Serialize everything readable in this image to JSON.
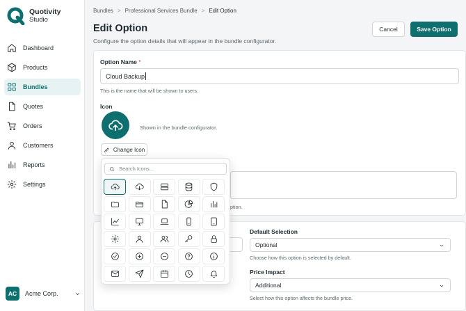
{
  "app": {
    "name": "Quotivity",
    "subtitle": "Studio"
  },
  "colors": {
    "accent": "#0f6e6e",
    "accent_light": "#e7f2f2",
    "required": "#d23b3b"
  },
  "sidebar": {
    "items": [
      {
        "label": "Dashboard",
        "icon": "home-icon"
      },
      {
        "label": "Products",
        "icon": "box-icon"
      },
      {
        "label": "Bundles",
        "icon": "bundle-grid-icon",
        "active": true
      },
      {
        "label": "Quotes",
        "icon": "document-icon"
      },
      {
        "label": "Orders",
        "icon": "cart-icon"
      },
      {
        "label": "Customers",
        "icon": "user-icon"
      },
      {
        "label": "Reports",
        "icon": "bar-chart-icon"
      },
      {
        "label": "Settings",
        "icon": "gear-icon"
      }
    ],
    "account": {
      "initials": "AC",
      "name": "Acme Corp."
    }
  },
  "breadcrumb": [
    "Bundles",
    "Professional Services Bundle",
    "Edit Option"
  ],
  "page": {
    "title": "Edit Option",
    "subtitle": "Configure the option details that will appear in the bundle configurator.",
    "cancel_label": "Cancel",
    "save_label": "Save Option"
  },
  "form": {
    "option_name_label": "Option Name",
    "required_mark": "*",
    "option_name_value": "Cloud Backup",
    "option_name_hint": "This is the name that will be shown to users.",
    "icon_label": "Icon",
    "icon_hint": "Shown in the bundle configurator.",
    "change_icon_label": "Change Icon",
    "partial_hint": "ption.",
    "default_selection_label": "Default Selection",
    "default_selection_value": "Optional",
    "default_selection_hint": "Choose how this option is selected by default.",
    "price_impact_label": "Price Impact",
    "price_impact_value": "Additional",
    "price_impact_hint": "Select how this option affects the bundle price."
  },
  "icon_picker": {
    "search_placeholder": "Search Icons...",
    "icons": [
      "cloud-upload-icon",
      "cloud-download-icon",
      "server-icon",
      "database-icon",
      "shield-icon",
      "folder-icon",
      "folder-open-icon",
      "file-icon",
      "pie-chart-icon",
      "bar-chart-icon",
      "line-chart-icon",
      "monitor-icon",
      "laptop-icon",
      "phone-icon",
      "tablet-icon",
      "gear-icon",
      "user-icon",
      "users-icon",
      "key-icon",
      "lock-icon",
      "check-circle-icon",
      "plus-circle-icon",
      "minus-circle-icon",
      "help-circle-icon",
      "info-circle-icon",
      "mail-icon",
      "send-icon",
      "calendar-icon",
      "clock-icon",
      "bell-icon"
    ],
    "selected": "cloud-upload-icon"
  }
}
